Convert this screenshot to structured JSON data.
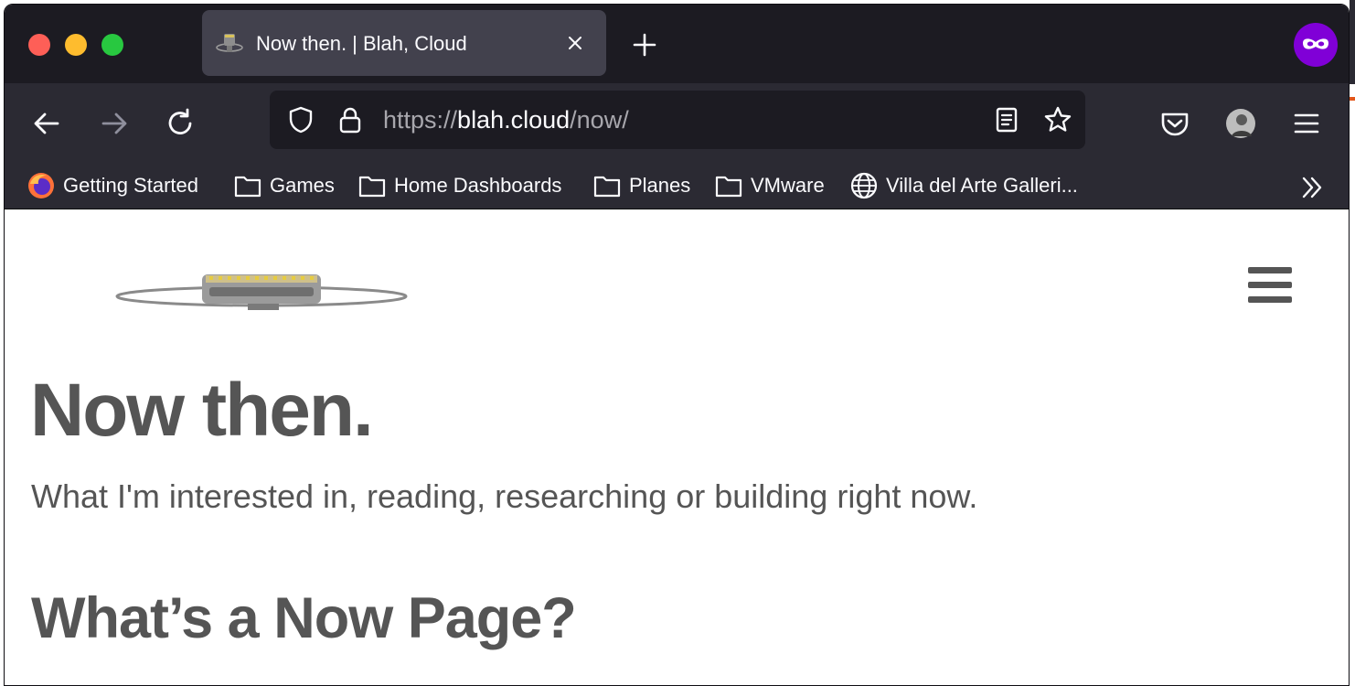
{
  "colors": {
    "tabstrip_bg": "#1c1b22",
    "toolbar_bg": "#2b2a33",
    "active_tab_bg": "#42414d",
    "urlbar_bg": "#1c1b22",
    "page_text": "#555555",
    "account_purple": "#8000d7"
  },
  "window_controls": {
    "close": "close-window",
    "minimize": "minimize-window",
    "zoom": "zoom-window"
  },
  "tab": {
    "title": "Now then. | Blah, Cloud",
    "favicon": "site-favicon"
  },
  "url": {
    "scheme": "https://",
    "host": "blah.cloud",
    "path": "/now/"
  },
  "bookmarks": [
    {
      "label": "Getting Started",
      "icon": "firefox-icon"
    },
    {
      "label": "Games",
      "icon": "folder-icon"
    },
    {
      "label": "Home Dashboards",
      "icon": "folder-icon"
    },
    {
      "label": "Planes",
      "icon": "folder-icon"
    },
    {
      "label": "VMware",
      "icon": "folder-icon"
    },
    {
      "label": "Villa del Arte Galleri...",
      "icon": "globe-icon"
    }
  ],
  "page": {
    "title": "Now then.",
    "subtitle": "What I'm interested in, reading, researching or building right now.",
    "section_heading": "What’s a Now Page?"
  }
}
